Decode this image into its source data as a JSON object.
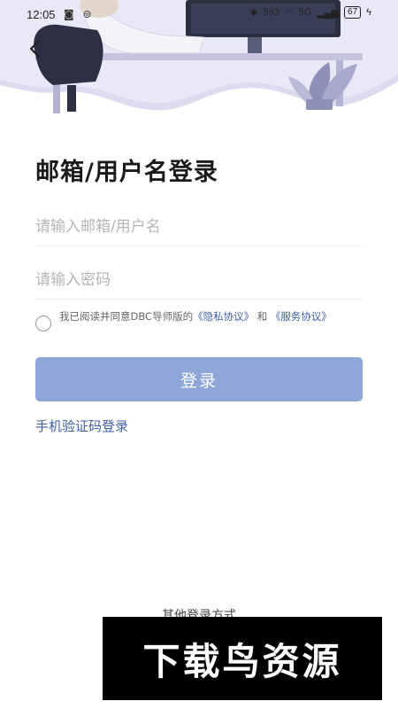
{
  "status_bar": {
    "time": "12:05",
    "left_icons": "◙ ⊜",
    "network_speed": "593",
    "signal": "5G",
    "battery": "67"
  },
  "header": {
    "back_icon": "chevron-left-icon"
  },
  "login": {
    "title": "邮箱/用户名登录",
    "account_placeholder": "请输入邮箱/用户名",
    "password_placeholder": "请输入密码",
    "agreement_prefix": "我已阅读并同意DBC导师版的",
    "privacy_link": "《隐私协议》",
    "agreement_and": "和",
    "service_link": "《服务协议》",
    "login_button": "登录",
    "sms_login": "手机验证码登录",
    "other_methods": "其他登录方式"
  },
  "watermark": {
    "text": "下载鸟资源"
  },
  "colors": {
    "primary_button": "#8fa6d8",
    "link": "#3f5fa8",
    "header_purple": "#c9c7e6"
  }
}
